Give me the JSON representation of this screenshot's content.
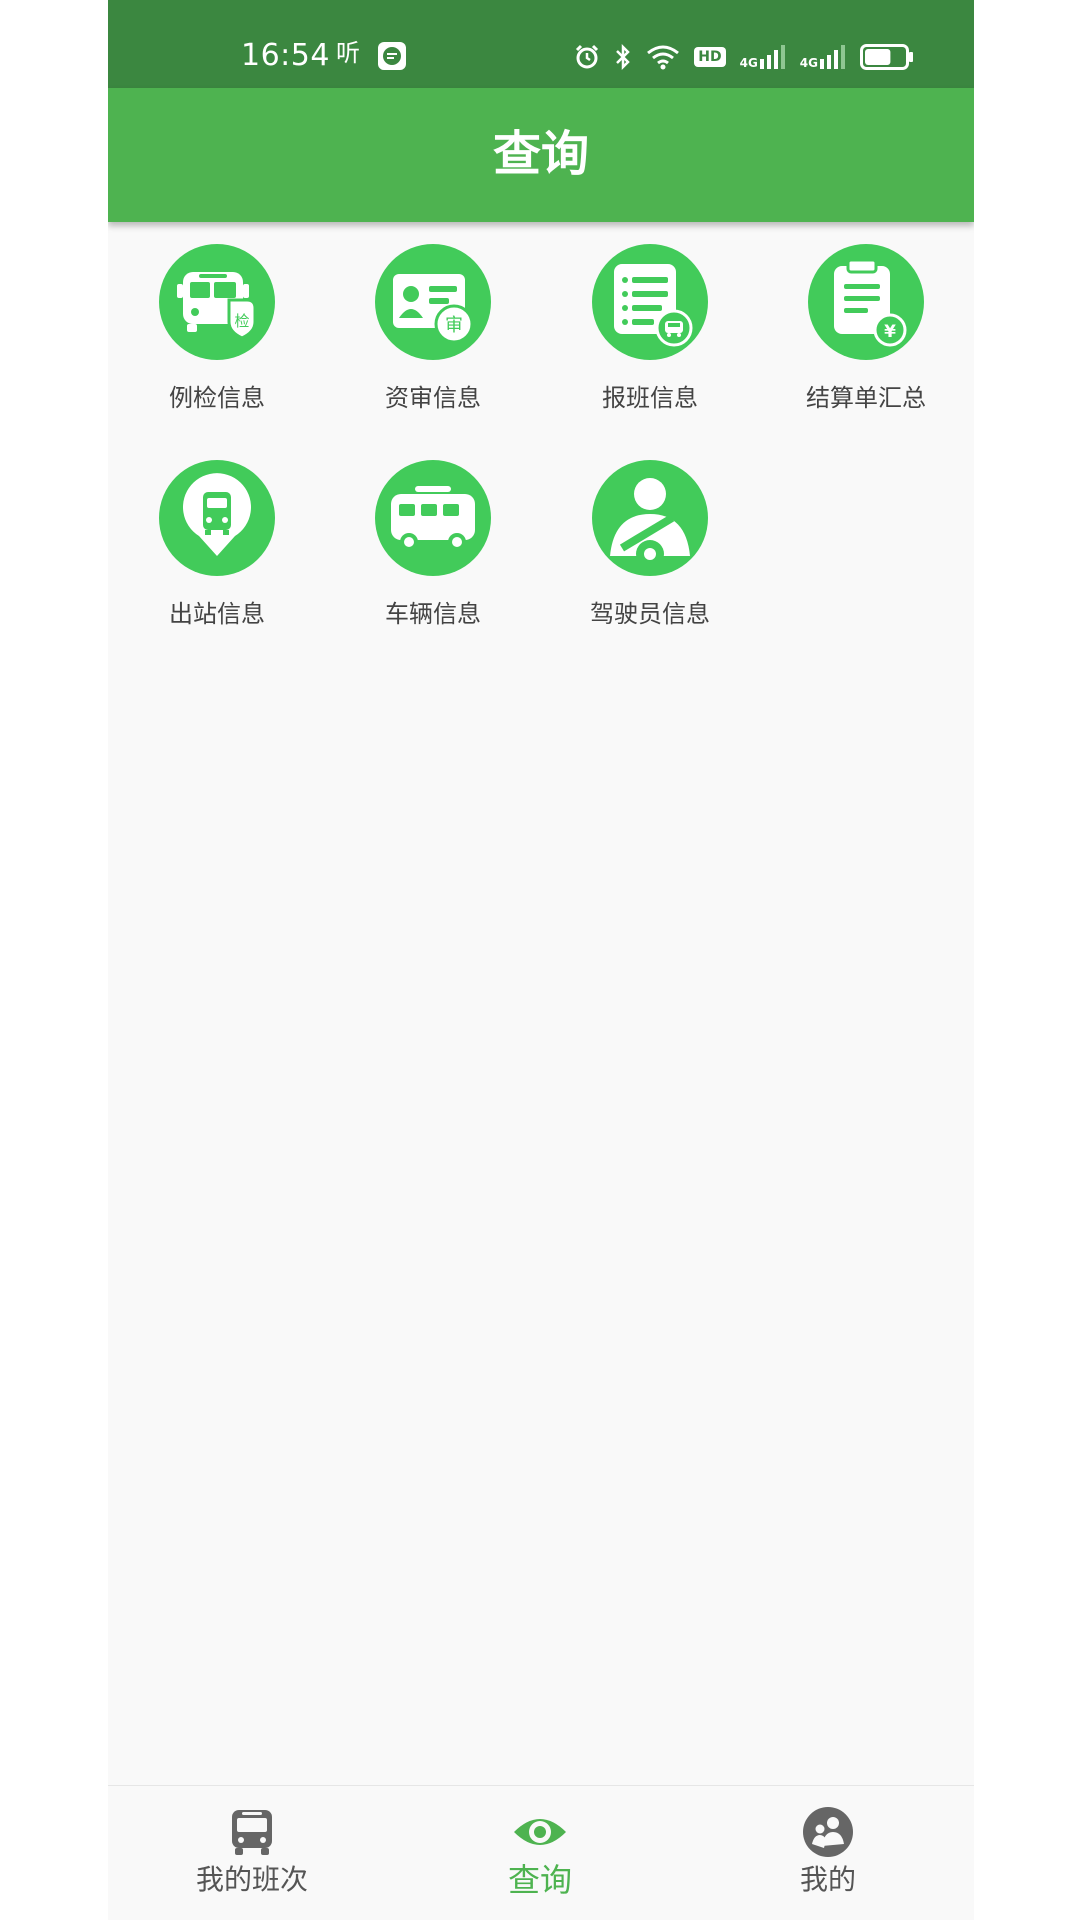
{
  "status_bar": {
    "time": "16:54",
    "left_glyph": "听",
    "hd_label": "HD",
    "net1": "4G",
    "net2": "4G",
    "battery_level": 0.65
  },
  "app_bar": {
    "title": "查询"
  },
  "grid": {
    "items": [
      {
        "label": "例检信息",
        "icon": "bus-inspection-icon",
        "badge": "检"
      },
      {
        "label": "资审信息",
        "icon": "id-card-review-icon",
        "badge": "审"
      },
      {
        "label": "报班信息",
        "icon": "schedule-list-icon",
        "badge": ""
      },
      {
        "label": "结算单汇总",
        "icon": "clipboard-yen-icon",
        "badge": "¥"
      },
      {
        "label": "出站信息",
        "icon": "station-location-icon",
        "badge": ""
      },
      {
        "label": "车辆信息",
        "icon": "vehicle-icon",
        "badge": ""
      },
      {
        "label": "驾驶员信息",
        "icon": "driver-icon",
        "badge": ""
      }
    ]
  },
  "bottom_nav": {
    "items": [
      {
        "label": "我的班次",
        "icon": "bus-icon"
      },
      {
        "label": "查询",
        "icon": "eye-icon",
        "active": true
      },
      {
        "label": "我的",
        "icon": "user-icon"
      }
    ]
  },
  "colors": {
    "status_bar": "#3b8740",
    "app_bar": "#4eb350",
    "icon_circle": "#42cb5a",
    "active_nav": "#4eb350"
  }
}
